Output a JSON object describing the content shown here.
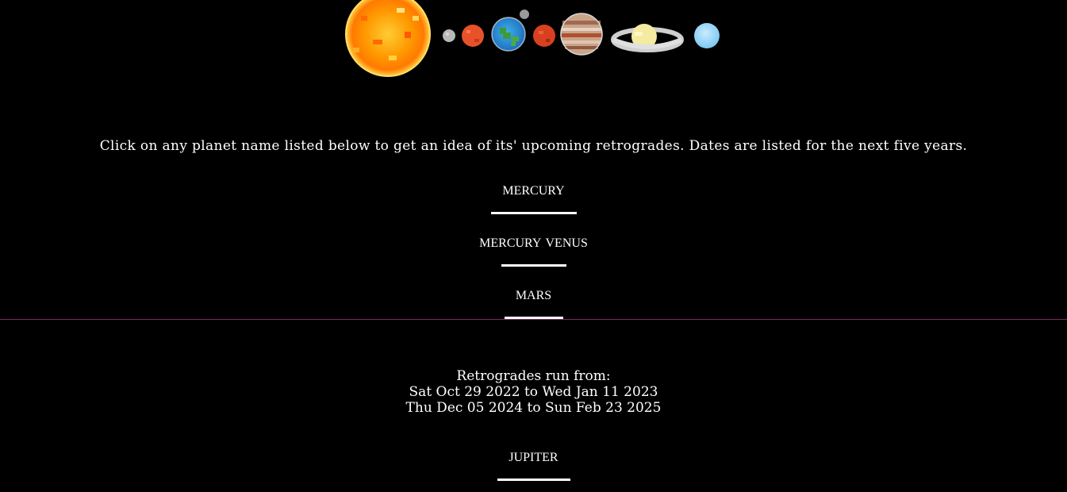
{
  "intro_text": "Click on any planet name listed below to get an idea of its' upcoming retrogrades. Dates are listed for the next five years.",
  "planets": [
    {
      "label": "MERCURY"
    },
    {
      "label": "VENUS"
    },
    {
      "label": "MARS"
    },
    {
      "label": "JUPITER"
    }
  ],
  "retrograde": {
    "heading": "Retrogrades run from:",
    "ranges": [
      "Sat Oct 29 2022 to Wed Jan 11 2023",
      "Thu Dec 05 2024 to Sun Feb 23 2025"
    ]
  },
  "colors": {
    "background": "#000000",
    "text": "#ffffff",
    "divider": "#7a2a5a"
  },
  "icons": [
    "sun-icon",
    "moon-icon",
    "mercury-icon",
    "earth-icon",
    "mars-icon",
    "jupiter-icon",
    "saturn-icon",
    "uranus-icon"
  ]
}
